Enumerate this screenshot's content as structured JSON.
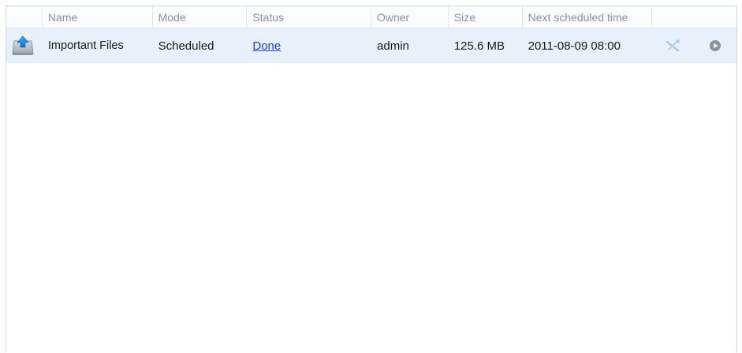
{
  "table": {
    "columns": [
      "",
      "Name",
      "Mode",
      "Status",
      "Owner",
      "Size",
      "Next scheduled time",
      ""
    ],
    "rows": [
      {
        "icon": "backup-upload-icon",
        "name": "Important Files",
        "mode": "Scheduled",
        "status": "Done",
        "owner": "admin",
        "size": "125.6 MB",
        "next_scheduled_time": "2011-08-09 08:00",
        "actions": [
          "edit-tools-icon",
          "run-play-icon"
        ]
      }
    ]
  },
  "colors": {
    "row_selected": "#e7f0fb",
    "link": "#1a3fd6",
    "header_text": "#8a8f96",
    "border": "#cfd8e2"
  }
}
